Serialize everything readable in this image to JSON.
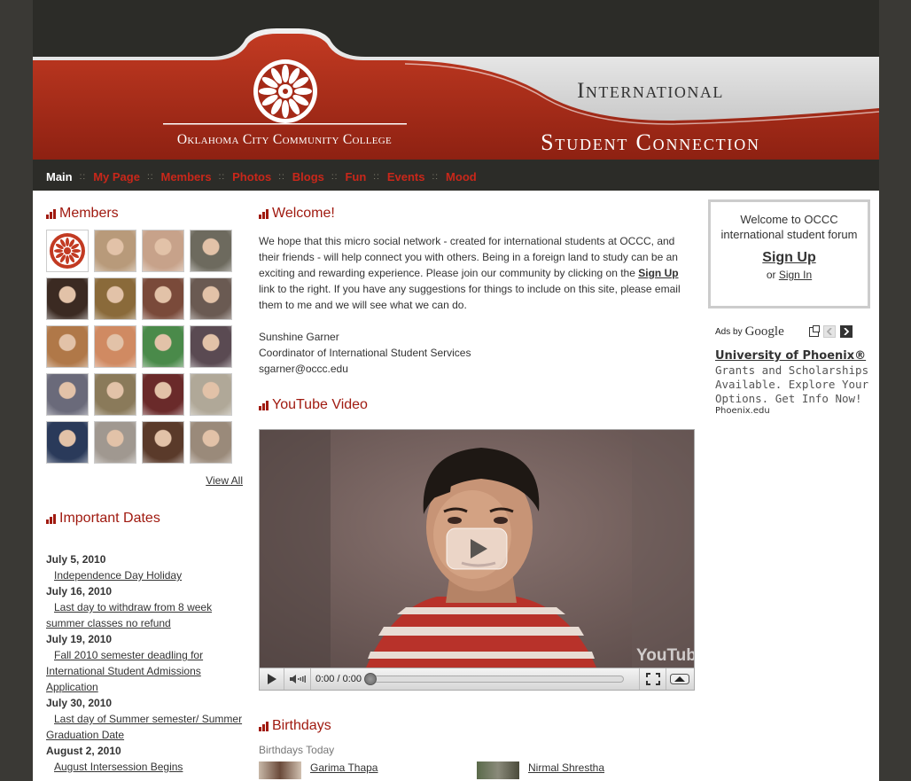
{
  "header": {
    "college_name": "Oklahoma City Community College",
    "title_line1": "International",
    "title_line2": "Student Connection"
  },
  "nav": {
    "items": [
      {
        "label": "Main",
        "active": true
      },
      {
        "label": "My Page"
      },
      {
        "label": "Members"
      },
      {
        "label": "Photos"
      },
      {
        "label": "Blogs"
      },
      {
        "label": "Fun"
      },
      {
        "label": "Events"
      },
      {
        "label": "Mood"
      }
    ],
    "separator": "::"
  },
  "members": {
    "title": "Members",
    "view_all": "View All",
    "thumb_colors": [
      "#ffffff",
      "#b89a7a",
      "#c7a28a",
      "#6d6a5e",
      "#3b2a22",
      "#8a6a3a",
      "#7a4a3a",
      "#6a5a52",
      "#b07848",
      "#d08a62",
      "#4a8a4a",
      "#5a4a52",
      "#6a6a7a",
      "#8a7a5a",
      "#6a2a2a",
      "#b0a898",
      "#2a3a5a",
      "#a09890",
      "#5a3a2a",
      "#9a8a7a"
    ]
  },
  "dates": {
    "title": "Important Dates",
    "items": [
      {
        "date": "July 5, 2010",
        "event": "Independence Day Holiday"
      },
      {
        "date": "July 16, 2010",
        "event": "Last day to withdraw from 8 week summer classes no refund"
      },
      {
        "date": "July 19, 2010",
        "event": "Fall 2010 semester deadling for International Student Admissions Application"
      },
      {
        "date": "July 30, 2010",
        "event": "Last day of Summer semester/ Summer Graduation Date"
      },
      {
        "date": "August 2, 2010",
        "event": "August Intersession Begins"
      }
    ]
  },
  "welcome": {
    "title": "Welcome!",
    "text_before": "We hope that this micro social network - created for international students at OCCC, and their friends - will help connect you with others. Being in a foreign land to study can be an exciting and rewarding experience. Please join our community by clicking on the ",
    "link": "Sign Up",
    "text_after": " link to the right. If you have any suggestions for things to include on this site, please email them to me and we will see what we can do.",
    "sig_name": "Sunshine Garner",
    "sig_title": "Coordinator of International Student Services",
    "sig_email": "sgarner@occc.edu"
  },
  "video": {
    "title": "YouTube Video",
    "time": "0:00 / 0:00",
    "watermark": "YouTube"
  },
  "birthdays": {
    "title": "Birthdays",
    "subtitle": "Birthdays Today",
    "people": [
      {
        "name": "Garima Thapa"
      },
      {
        "name": "Nirmal Shrestha"
      }
    ]
  },
  "login": {
    "welcome": "Welcome to OCCC international student forum",
    "signup": "Sign Up",
    "or": "or",
    "signin": "Sign In"
  },
  "ads": {
    "label": "Ads by",
    "brand": "Google",
    "title": "University of Phoenix®",
    "text": "Grants and Scholarships Available. Explore Your Options. Get Info Now!",
    "url": "Phoenix.edu"
  },
  "colors": {
    "brand_red": "#a01a10",
    "nav_red": "#c9271a",
    "dark_bg": "#3a3935"
  }
}
